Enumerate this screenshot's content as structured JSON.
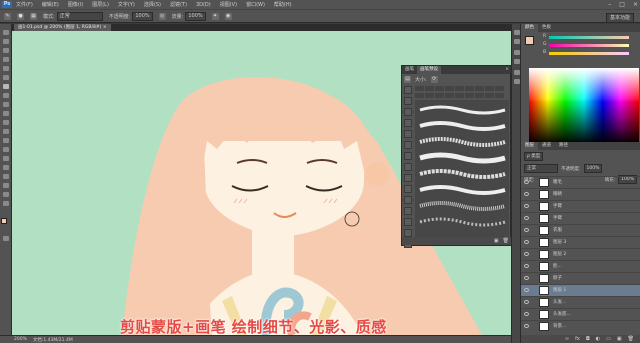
{
  "menubar": {
    "app_logo": "Ps",
    "items": [
      "文件(F)",
      "编辑(E)",
      "图像(I)",
      "图层(L)",
      "文字(Y)",
      "选择(S)",
      "滤镜(T)",
      "3D(D)",
      "视图(V)",
      "窗口(W)",
      "帮助(H)"
    ],
    "window_controls": [
      "–",
      "□",
      "×"
    ]
  },
  "options": {
    "mode_label": "模式:",
    "mode_value": "正常",
    "opacity_label": "不透明度:",
    "opacity_value": "100%",
    "flow_label": "流量:",
    "flow_value": "100%",
    "workspace": "基本功能"
  },
  "document": {
    "tab_title": "画1-01.psd @ 200% (图层 1, RGB/8#)",
    "tab_close": "×"
  },
  "caption": "剪贴蒙版+画笔 绘制细节、光影、质感",
  "statusbar": {
    "zoom": "200%",
    "doc_info": "文档:1.43M/21.4M"
  },
  "brush_panel": {
    "tabs": [
      "画笔",
      "画笔预设"
    ],
    "header_label": "大小:",
    "close": "×",
    "grid_values": [
      "30",
      "30",
      "30",
      "25",
      "25",
      "25",
      "36",
      "25",
      "36",
      "36",
      "36",
      "32",
      "25",
      "14",
      "24",
      "27",
      "39",
      "46",
      "59"
    ]
  },
  "color_panel": {
    "tabs": [
      "颜色",
      "色板"
    ],
    "sliders": [
      "R",
      "G",
      "B"
    ]
  },
  "layers_panel": {
    "tabs": [
      "图层",
      "通道",
      "路径"
    ],
    "kind_label": "ρ 类型",
    "blend_mode": "正常",
    "opacity_label": "不透明度:",
    "opacity_value": "100%",
    "lock_label": "锁定:",
    "fill_label": "填充:",
    "fill_value": "100%",
    "layers": [
      {
        "name": "睫毛",
        "selected": false
      },
      {
        "name": "眼睛",
        "selected": false
      },
      {
        "name": "手臂",
        "selected": false
      },
      {
        "name": "手臂",
        "selected": false
      },
      {
        "name": "衣服",
        "selected": false
      },
      {
        "name": "图层 3",
        "selected": false
      },
      {
        "name": "图层 2",
        "selected": false
      },
      {
        "name": "脸...",
        "selected": false
      },
      {
        "name": "脖子",
        "selected": false
      },
      {
        "name": "图层 1",
        "selected": true
      },
      {
        "name": "头发...",
        "selected": false
      },
      {
        "name": "头发底...",
        "selected": false
      },
      {
        "name": "背景...",
        "selected": false
      },
      {
        "name": "背",
        "selected": false
      }
    ]
  },
  "colors": {
    "canvas_bg": "#b2e0c3",
    "hair": "#f7cbb0",
    "skin": "#fdf1e2",
    "caption_red": "#e64a44"
  }
}
